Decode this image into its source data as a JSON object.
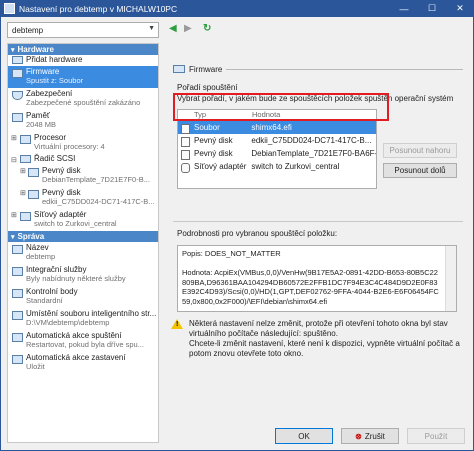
{
  "window": {
    "title": "Nastavení pro debtemp v MICHALW10PC"
  },
  "toolbar": {
    "vm_name": "debtemp",
    "back": "◀",
    "forward": "▶",
    "refresh": "↻"
  },
  "sidebar": {
    "hardware_header": "Hardware",
    "management_header": "Správa",
    "items": [
      {
        "label": "Přidat hardware",
        "sub": ""
      },
      {
        "label": "Firmware",
        "sub": "Spustit z: Soubor"
      },
      {
        "label": "Zabezpečení",
        "sub": "Zabezpečené spouštění zakázáno"
      },
      {
        "label": "Paměť",
        "sub": "2048 MB"
      },
      {
        "label": "Procesor",
        "sub": "Virtuální procesory: 4"
      },
      {
        "label": "Řadič SCSI",
        "sub": ""
      },
      {
        "label": "Pevný disk",
        "sub": "DebianTemplate_7D21E7F0-B..."
      },
      {
        "label": "Pevný disk",
        "sub": "edkii_C75DD024-DC71-417C-B..."
      },
      {
        "label": "Síťový adaptér",
        "sub": "switch to Zurkovi_central"
      },
      {
        "label": "Název",
        "sub": "debtemp"
      },
      {
        "label": "Integrační služby",
        "sub": "Byly nabídnuty některé služby"
      },
      {
        "label": "Kontrolní body",
        "sub": "Standardní"
      },
      {
        "label": "Umístění souboru inteligentního str...",
        "sub": "D:\\VM\\debtemp\\debtemp"
      },
      {
        "label": "Automatická akce spuštění",
        "sub": "Restartovat, pokud byla dříve spu..."
      },
      {
        "label": "Automatická akce zastavení",
        "sub": "Uložit"
      }
    ]
  },
  "panel": {
    "header": "Firmware",
    "boot_order_label": "Pořadí spouštění",
    "boot_order_desc": "Vybrat pořadí, v jakém bude ze spouštěcích položek spuštěn operační systém",
    "col_type": "Typ",
    "col_value": "Hodnota",
    "rows": [
      {
        "type": "Soubor",
        "value": "shimx64.efi"
      },
      {
        "type": "Pevný disk",
        "value": "edkii_C75DD024-DC71-417C-B..."
      },
      {
        "type": "Pevný disk",
        "value": "DebianTemplate_7D21E7F0-BA6F-..."
      },
      {
        "type": "Síťový adaptér",
        "value": "switch to Zurkovi_central"
      }
    ],
    "move_up": "Posunout nahoru",
    "move_down": "Posunout dolů",
    "detail_label": "Podrobnosti pro vybranou spouštěcí položku:",
    "detail_text": "Popis: DOES_NOT_MATTER\n\nHodnota: AcpiEx(VMBus,0,0)/VenHw(9B17E5A2-0891-42DD-B653-80B5C22809BA,D96361BAA104294DB60572E2FFB1DC7F94E3C4C484D9D2E0F83E392C4D93)/Scsi(0,0)/HD(1,GPT,DEF02762-9FFA-4044-B2E6-E6F06454FC59,0x800,0x2F000)/\\EFI\\debian\\shimx64.efi",
    "warning": "Některá nastavení nelze změnit, protože při otevření tohoto okna byl stav virtuálního počítače následující: spuštěno.\nChcete-li změnit nastavení, které není k dispozici, vypněte virtuální počítač a potom znovu otevřete toto okno."
  },
  "footer": {
    "ok": "OK",
    "cancel": "Zrušit",
    "apply": "Použít"
  }
}
